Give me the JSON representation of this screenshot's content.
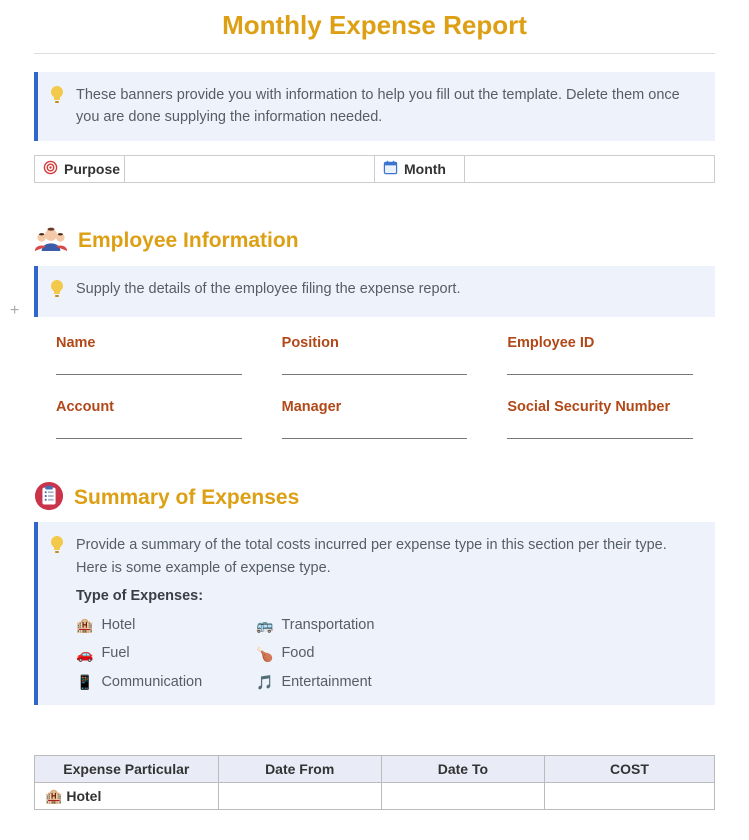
{
  "title": "Monthly Expense Report",
  "banners": {
    "top": "These banners provide you with information to help you fill out the template. Delete them once you are done supplying the information needed.",
    "employee": "Supply the details of the employee filing the expense report.",
    "summary_intro": "Provide a summary of the total costs incurred per expense type in this section per their type. Here is some example of expense type.",
    "summary_strong": "Type of Expenses:"
  },
  "purposeRow": {
    "purposeLabel": "Purpose",
    "monthLabel": "Month"
  },
  "sections": {
    "employee": "Employee Information",
    "summary": "Summary of Expenses"
  },
  "employeeFields": {
    "name": "Name",
    "position": "Position",
    "employeeId": "Employee ID",
    "account": "Account",
    "manager": "Manager",
    "ssn": "Social Security Number"
  },
  "expenseTypes": {
    "hotel": "Hotel",
    "transportation": "Transportation",
    "fuel": "Fuel",
    "food": "Food",
    "communication": "Communication",
    "entertainment": "Entertainment"
  },
  "expenseTable": {
    "headers": {
      "particular": "Expense Particular",
      "dateFrom": "Date From",
      "dateTo": "Date To",
      "cost": "COST"
    },
    "rows": [
      {
        "particular": "Hotel",
        "dateFrom": "",
        "dateTo": "",
        "cost": ""
      }
    ]
  }
}
